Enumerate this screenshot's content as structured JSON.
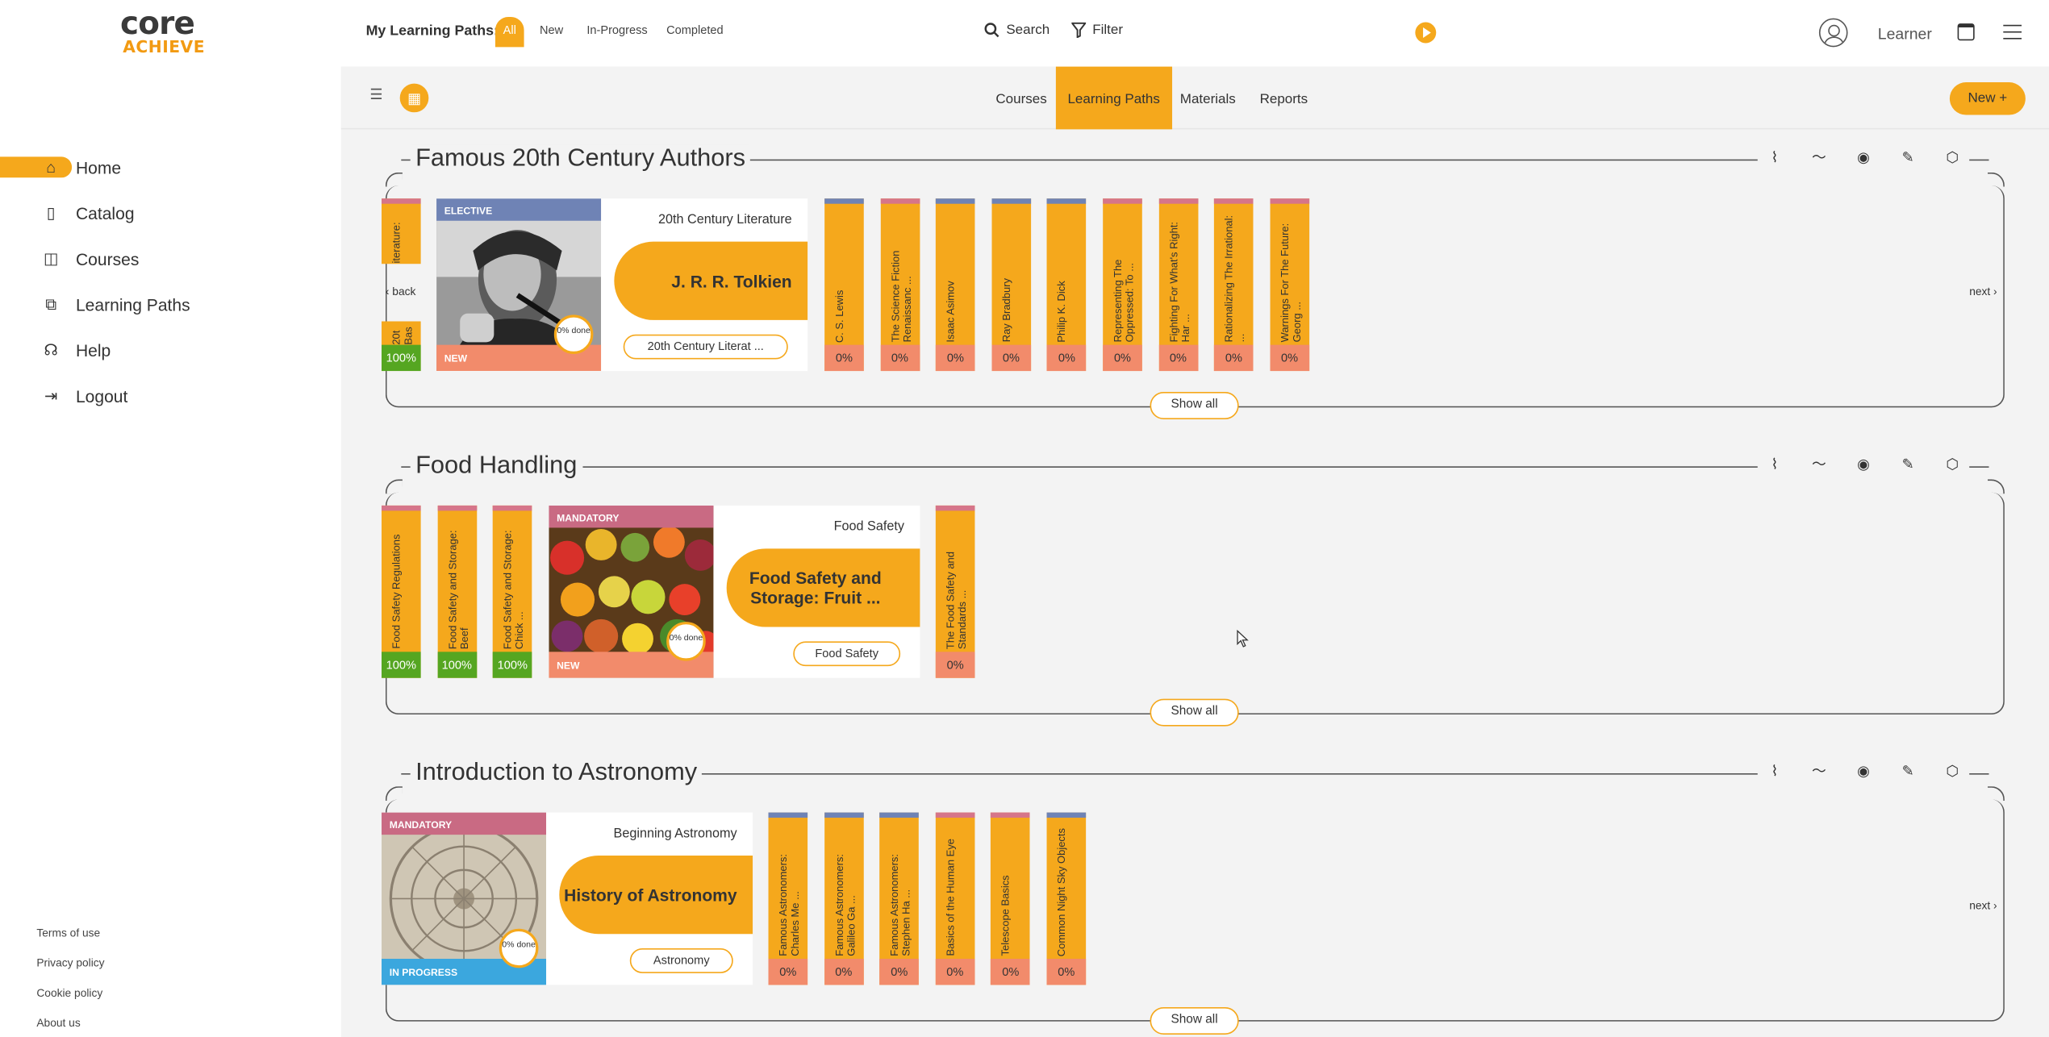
{
  "logo": {
    "line1": "core",
    "line2": "ACHIEVE"
  },
  "topbar": {
    "my_learning_paths": "My Learning Paths:",
    "filters": [
      "All",
      "New",
      "In-Progress",
      "Completed"
    ],
    "search": "Search",
    "filter": "Filter",
    "learner": "Learner"
  },
  "sidebar": {
    "items": [
      {
        "label": "Home",
        "icon": "home-icon"
      },
      {
        "label": "Catalog",
        "icon": "book-icon"
      },
      {
        "label": "Courses",
        "icon": "open-book-icon"
      },
      {
        "label": "Learning Paths",
        "icon": "puzzle-icon"
      },
      {
        "label": "Help",
        "icon": "headset-icon"
      },
      {
        "label": "Logout",
        "icon": "logout-icon"
      }
    ],
    "footer": [
      "Terms of use",
      "Privacy policy",
      "Cookie policy",
      "About us"
    ]
  },
  "subnav": {
    "tabs": [
      "Courses",
      "Learning Paths",
      "Materials",
      "Reports"
    ],
    "new_button": "New +"
  },
  "sections": [
    {
      "title": "Famous 20th Century Authors",
      "back": "back",
      "next": "next",
      "show_all": "Show all",
      "left_stack": {
        "top": "iterature:",
        "bottom": "20t Bas",
        "pct": "100%"
      },
      "card": {
        "tag": "ELECTIVE",
        "status": "NEW",
        "progress": "0% done",
        "category": "20th Century Literature",
        "title": "J. R. R. Tolkien",
        "chip": "20th Century Literat ..."
      },
      "bars": [
        {
          "label": "C. S. Lewis",
          "pct": "0%"
        },
        {
          "label": "The Science Fiction Renaissanc ...",
          "pct": "0%"
        },
        {
          "label": "Isaac Asimov",
          "pct": "0%"
        },
        {
          "label": "Ray Bradbury",
          "pct": "0%"
        },
        {
          "label": "Philip K. Dick",
          "pct": "0%"
        },
        {
          "label": "Representing The Oppressed: To ...",
          "pct": "0%"
        },
        {
          "label": "Fighting For What's Right: Har ...",
          "pct": "0%"
        },
        {
          "label": "Rationalizing The Irrational: ...",
          "pct": "0%"
        },
        {
          "label": "Warnings For The Future: Georg ...",
          "pct": "0%"
        }
      ]
    },
    {
      "title": "Food Handling",
      "show_all": "Show all",
      "left_bars": [
        {
          "label": "Food Safety Regulations",
          "pct": "100%"
        },
        {
          "label": "Food Safety and Storage: Beef",
          "pct": "100%"
        },
        {
          "label": "Food Safety and Storage: Chick ...",
          "pct": "100%"
        }
      ],
      "card": {
        "tag": "MANDATORY",
        "status": "NEW",
        "progress": "0% done",
        "category": "Food Safety",
        "title": "Food Safety and Storage: Fruit ...",
        "chip": "Food Safety"
      },
      "bars": [
        {
          "label": "The Food Safety and Standards ...",
          "pct": "0%"
        }
      ]
    },
    {
      "title": "Introduction to Astronomy",
      "next": "next",
      "show_all": "Show all",
      "card": {
        "tag": "MANDATORY",
        "status": "IN PROGRESS",
        "progress": "0% done",
        "category": "Beginning Astronomy",
        "title": "History of Astronomy",
        "chip": "Astronomy"
      },
      "bars": [
        {
          "label": "Famous Astronomers: Charles Me ...",
          "pct": "0%"
        },
        {
          "label": "Famous Astronomers: Galileo Ga ...",
          "pct": "0%"
        },
        {
          "label": "Famous Astronomers: Stephen Ha ...",
          "pct": "0%"
        },
        {
          "label": "Basics of the Human Eye",
          "pct": "0%"
        },
        {
          "label": "Telescope Basics",
          "pct": "0%"
        },
        {
          "label": "Common Night Sky Objects",
          "pct": "0%"
        }
      ]
    }
  ],
  "colors": {
    "accent": "#f5a81c",
    "done": "#55a621",
    "pct_bg": "#f28b6b",
    "elective": "#6f83b5",
    "mandatory": "#c96a83",
    "in_progress": "#3ba7de",
    "new": "#f28b6b"
  }
}
